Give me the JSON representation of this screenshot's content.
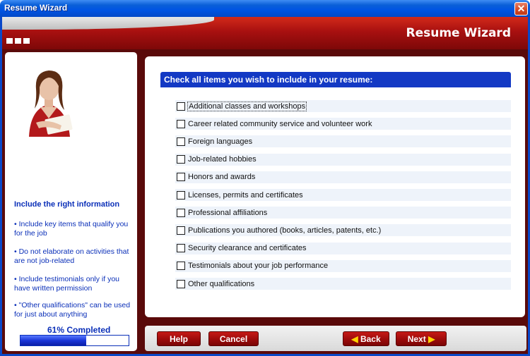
{
  "window": {
    "title": "Resume Wizard",
    "close_icon": "close-icon"
  },
  "banner": {
    "title": "Resume Wizard",
    "icon": "three-squares-icon"
  },
  "tips": {
    "heading": "Include the right information",
    "items": [
      "Include key items that qualify you for the job",
      "Do not elaborate on activities that are not job-related",
      "Include testimonials only if you have written permission",
      "\"Other qualifications\" can be used for just about anything"
    ]
  },
  "progress": {
    "label": "61% Completed",
    "percent": 61
  },
  "main": {
    "header": "Check all items you wish to include in your resume:",
    "options": [
      {
        "label": "Additional classes and workshops",
        "checked": false
      },
      {
        "label": "Career related community service and volunteer work",
        "checked": false
      },
      {
        "label": "Foreign languages",
        "checked": false
      },
      {
        "label": "Job-related hobbies",
        "checked": false
      },
      {
        "label": "Honors and awards",
        "checked": false
      },
      {
        "label": "Licenses, permits and certificates",
        "checked": false
      },
      {
        "label": "Professional affiliations",
        "checked": false
      },
      {
        "label": "Publications you authored (books, articles, patents, etc.)",
        "checked": false
      },
      {
        "label": "Security clearance and certificates",
        "checked": false
      },
      {
        "label": "Testimonials about your job performance",
        "checked": false
      },
      {
        "label": "Other qualifications",
        "checked": false
      }
    ]
  },
  "buttons": {
    "help": "Help",
    "cancel": "Cancel",
    "back": "Back",
    "next": "Next"
  },
  "colors": {
    "accent_red": "#a81010",
    "header_blue": "#1339c4",
    "text_blue": "#0a2fb8"
  }
}
